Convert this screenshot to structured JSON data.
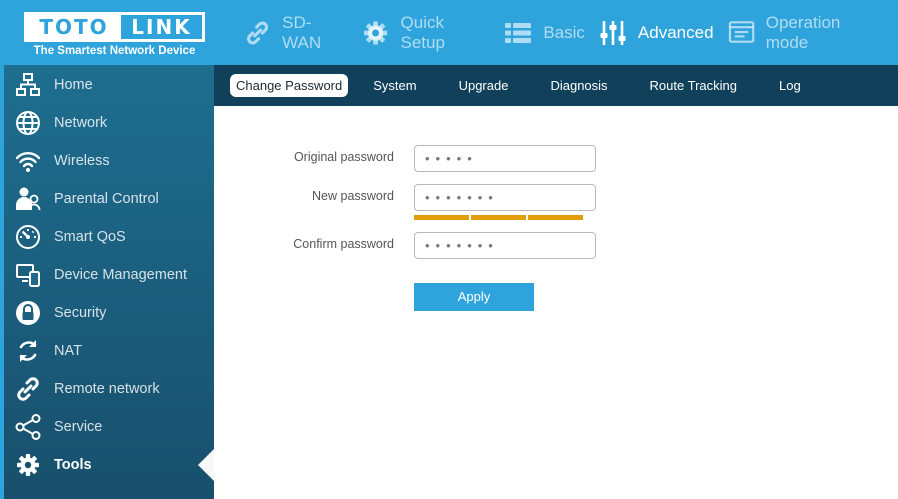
{
  "brand": {
    "logo_left": "TOTO",
    "logo_right": "LINK",
    "tagline": "The Smartest Network Device",
    "primary_color": "#2fa4dc",
    "accent_color": "#e49c0c"
  },
  "topnav": {
    "items": [
      {
        "label": "SD-WAN",
        "icon": "link-icon",
        "active": false
      },
      {
        "label": "Quick Setup",
        "icon": "gear-icon",
        "active": false
      },
      {
        "label": "Basic",
        "icon": "list-icon",
        "active": false
      },
      {
        "label": "Advanced",
        "icon": "sliders-icon",
        "active": true
      },
      {
        "label": "Operation mode",
        "icon": "window-icon",
        "active": false
      }
    ]
  },
  "sidebar": {
    "items": [
      {
        "label": "Home",
        "icon": "network-tree-icon"
      },
      {
        "label": "Network",
        "icon": "globe-icon"
      },
      {
        "label": "Wireless",
        "icon": "wifi-icon"
      },
      {
        "label": "Parental Control",
        "icon": "parent-child-icon"
      },
      {
        "label": "Smart QoS",
        "icon": "speedometer-icon"
      },
      {
        "label": "Device Management",
        "icon": "devices-icon"
      },
      {
        "label": "Security",
        "icon": "lock-icon"
      },
      {
        "label": "NAT",
        "icon": "refresh-icon"
      },
      {
        "label": "Remote network",
        "icon": "link-icon"
      },
      {
        "label": "Service",
        "icon": "share-icon"
      },
      {
        "label": "Tools",
        "icon": "gear-icon"
      }
    ],
    "active": "Tools"
  },
  "subtabs": {
    "items": [
      "Change Password",
      "System",
      "Upgrade",
      "Diagnosis",
      "Route Tracking",
      "Log"
    ],
    "active": "Change Password"
  },
  "form": {
    "original_label": "Original password",
    "original_value": "•••••",
    "new_label": "New password",
    "new_value": "•••••••",
    "strength_level": 1.0,
    "confirm_label": "Confirm password",
    "confirm_value": "•••••••",
    "apply_label": "Apply"
  }
}
